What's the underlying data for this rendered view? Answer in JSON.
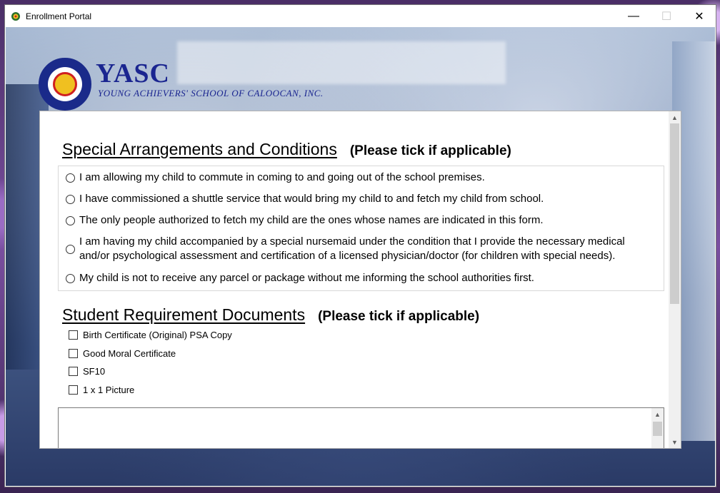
{
  "window": {
    "title": "Enrollment Portal",
    "minimize_glyph": "—",
    "maximize_glyph": "☐",
    "close_glyph": "✕"
  },
  "logo": {
    "name": "YASC",
    "subtitle": "YOUNG ACHIEVERS' SCHOOL OF CALOOCAN, INC."
  },
  "special_arrangements": {
    "title": "Special Arrangements and Conditions",
    "hint": "(Please tick if applicable)",
    "options": [
      "I am allowing my child to commute in coming to and going out of the school premises.",
      "I have commissioned a shuttle service that would bring my child to and fetch my child from school.",
      "The only people authorized to fetch my child are the ones whose names are indicated in this form.",
      "I am having my child accompanied by a special nursemaid under the condition that I provide the necessary medical and/or psychological assessment and certification of a licensed physician/doctor (for children with special needs).",
      "My child is not to receive any parcel or package without me informing the school authorities first."
    ]
  },
  "requirements": {
    "title": "Student Requirement Documents",
    "hint": "(Please tick if applicable)",
    "documents": [
      "Birth Certificate (Original) PSA Copy",
      "Good Moral Certificate",
      "SF10",
      "1 x 1 Picture"
    ]
  },
  "icons": {
    "scroll_up": "chevron-up-icon",
    "scroll_down": "chevron-down-icon"
  }
}
